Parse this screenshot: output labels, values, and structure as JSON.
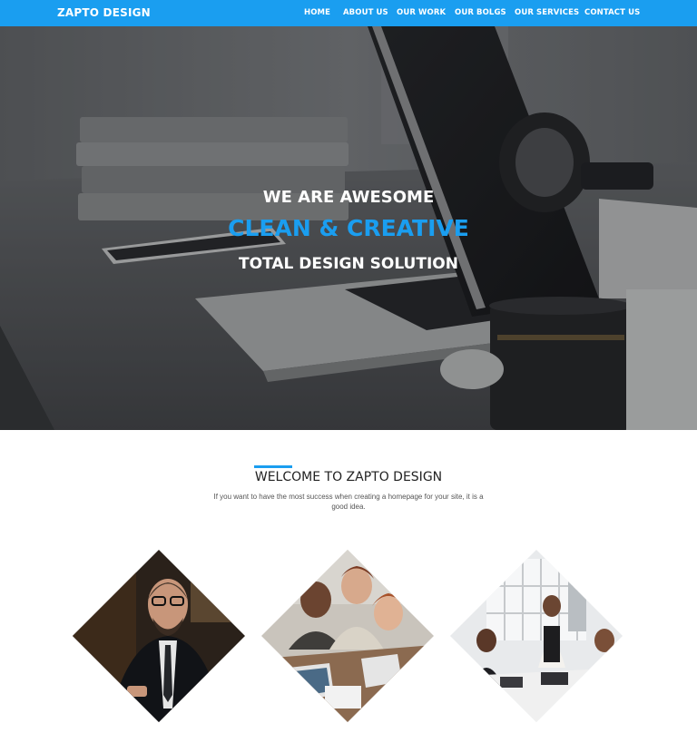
{
  "nav": {
    "brand": "ZAPTO DESIGN",
    "items": [
      {
        "label": "HOME"
      },
      {
        "label": "ABOUT US"
      },
      {
        "label": "OUR WORK"
      },
      {
        "label": "OUR BOLGS"
      },
      {
        "label": "OUR SERVICES"
      },
      {
        "label": "CONTACT US"
      }
    ]
  },
  "hero": {
    "line1": "WE ARE AWESOME",
    "line2": "CLEAN & CREATIVE",
    "line3": "TOTAL DESIGN SOLUTION"
  },
  "welcome": {
    "title": "WELCOME TO ZAPTO DESIGN",
    "text": "If you want to have the most success when creating a homepage for your site, it is a good idea."
  },
  "team_images": [
    {
      "subject": "businessman-with-glasses"
    },
    {
      "subject": "team-meeting-laptops"
    },
    {
      "subject": "office-meeting-presenter"
    }
  ],
  "colors": {
    "accent": "#1a9ef0",
    "nav_bg": "#1a9ef0"
  }
}
